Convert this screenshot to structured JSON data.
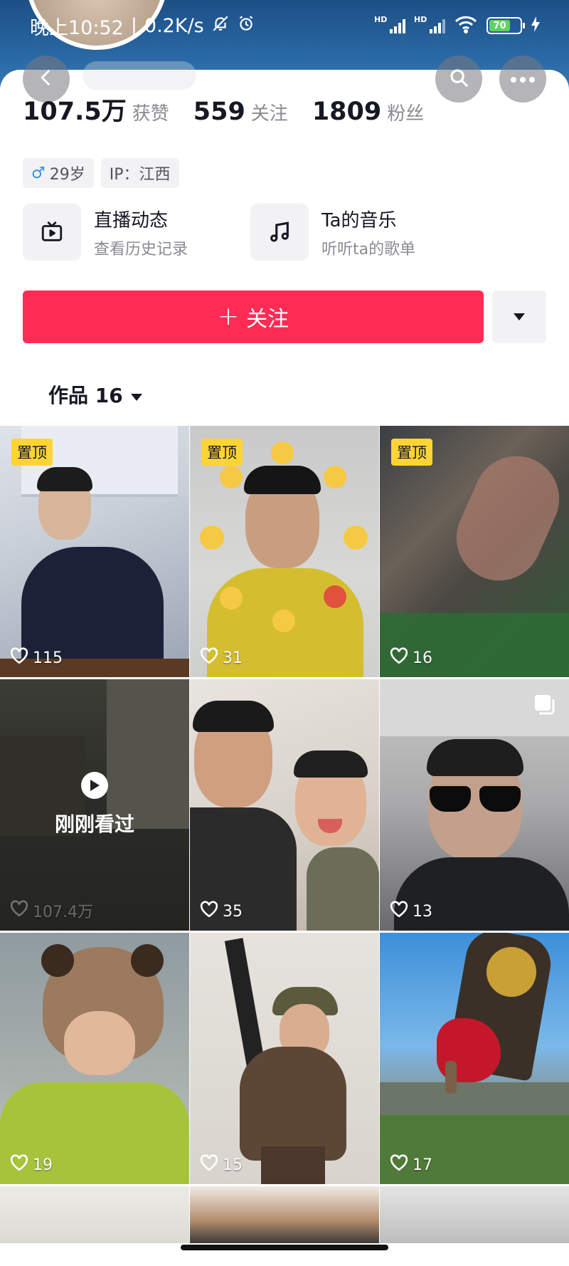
{
  "status_bar": {
    "time": "晚上10:52",
    "speed": "0.2K/s",
    "signal_1": "HD",
    "signal_2": "HD",
    "battery": "70"
  },
  "stats": [
    {
      "value": "107.5万",
      "label": "获赞"
    },
    {
      "value": "559",
      "label": "关注"
    },
    {
      "value": "1809",
      "label": "粉丝"
    }
  ],
  "tags": {
    "gender_age": "29岁",
    "ip": "IP：江西"
  },
  "shortcuts": [
    {
      "title": "直播动态",
      "subtitle": "查看历史记录",
      "icon": "tv-icon"
    },
    {
      "title": "Ta的音乐",
      "subtitle": "听听ta的歌单",
      "icon": "music-note-icon"
    }
  ],
  "follow_button": "关注",
  "works_tab": "作品 16",
  "grid": [
    {
      "pinned": "置顶",
      "likes": "115"
    },
    {
      "pinned": "置顶",
      "likes": "31"
    },
    {
      "pinned": "置顶",
      "likes": "16"
    },
    {
      "overlay": "刚刚看过",
      "likes": "107.4万"
    },
    {
      "likes": "35"
    },
    {
      "likes": "13",
      "multi": true
    },
    {
      "likes": "19"
    },
    {
      "likes": "15"
    },
    {
      "likes": "17"
    }
  ],
  "colors": {
    "accent": "#fe2c55",
    "pin": "#fcd535",
    "header": "#2a6aa6"
  }
}
